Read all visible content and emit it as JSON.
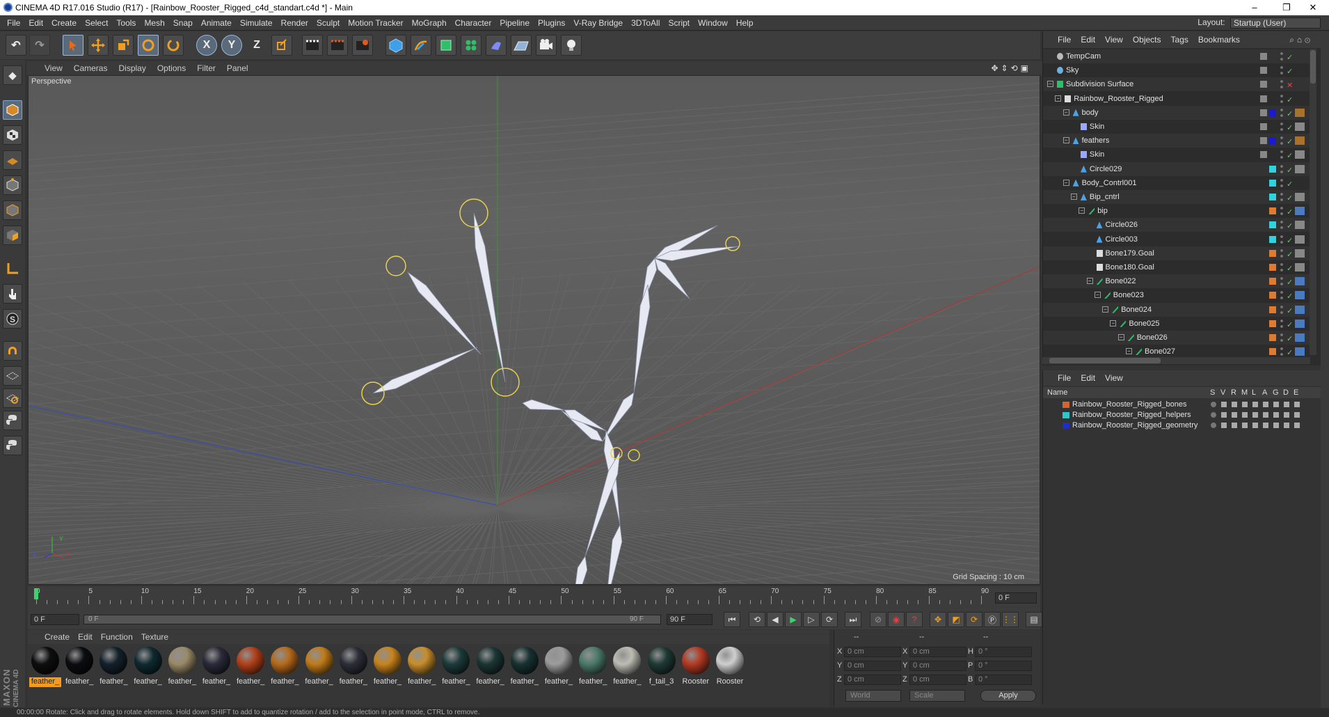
{
  "window": {
    "title": "CINEMA 4D R17.016 Studio (R17) - [Rainbow_Rooster_Rigged_c4d_standart.c4d *] - Main",
    "minimize": "–",
    "maximize": "❐",
    "close": "✕"
  },
  "menubar": [
    "File",
    "Edit",
    "Create",
    "Select",
    "Tools",
    "Mesh",
    "Snap",
    "Animate",
    "Simulate",
    "Render",
    "Sculpt",
    "Motion Tracker",
    "MoGraph",
    "Character",
    "Pipeline",
    "Plugins",
    "V-Ray Bridge",
    "3DToAll",
    "Script",
    "Window",
    "Help"
  ],
  "layout": {
    "label": "Layout:",
    "value": "Startup (User)"
  },
  "toolbar": {
    "x_label": "X",
    "y_label": "Y",
    "z_label": "Z"
  },
  "viewport": {
    "menu": [
      "View",
      "Cameras",
      "Display",
      "Options",
      "Filter",
      "Panel"
    ],
    "label": "Perspective",
    "grid_spacing": "Grid Spacing : 10 cm",
    "axis_x": "X",
    "axis_y": "Y",
    "axis_z": "Z"
  },
  "timeline": {
    "ticks": [
      "0",
      "5",
      "10",
      "15",
      "20",
      "25",
      "30",
      "35",
      "40",
      "45",
      "50",
      "55",
      "60",
      "65",
      "70",
      "75",
      "80",
      "85",
      "90"
    ],
    "current_frame": "0 F",
    "start_field": "0 F",
    "range_start": "0 F",
    "range_end": "90 F",
    "end_field": "90 F"
  },
  "materials": {
    "menu": [
      "Create",
      "Edit",
      "Function",
      "Texture"
    ],
    "items": [
      {
        "label": "feather_",
        "color": "#0e0e0e",
        "selected": true
      },
      {
        "label": "feather_",
        "color": "#0c0d10"
      },
      {
        "label": "feather_",
        "color": "#13212b"
      },
      {
        "label": "feather_",
        "color": "#0f2a30"
      },
      {
        "label": "feather_",
        "color": "#9a8a68"
      },
      {
        "label": "feather_",
        "color": "#2a2a3a"
      },
      {
        "label": "feather_",
        "color": "#b0401a"
      },
      {
        "label": "feather_",
        "color": "#b56a1c"
      },
      {
        "label": "feather_",
        "color": "#c07b1a"
      },
      {
        "label": "feather_",
        "color": "#2e2e3a"
      },
      {
        "label": "feather_",
        "color": "#c7841e"
      },
      {
        "label": "feather_",
        "color": "#c88e2a"
      },
      {
        "label": "feather_",
        "color": "#1d3b3a"
      },
      {
        "label": "feather_",
        "color": "#1c3535"
      },
      {
        "label": "feather_",
        "color": "#183232"
      },
      {
        "label": "feather_",
        "color": "#9c9c9c"
      },
      {
        "label": "feather_",
        "color": "#4c7a6a"
      },
      {
        "label": "feather_",
        "color": "#bdbdb5"
      },
      {
        "label": "f_tail_3",
        "color": "#1f3a33"
      },
      {
        "label": "Rooster",
        "color": "#b33a24"
      },
      {
        "label": "Rooster",
        "color": "#cfcfcf"
      }
    ]
  },
  "coords": {
    "headers": [
      "--",
      "--",
      "--"
    ],
    "rows": [
      {
        "l1": "X",
        "v1": "0 cm",
        "l2": "X",
        "v2": "0 cm",
        "l3": "H",
        "v3": "0 °"
      },
      {
        "l1": "Y",
        "v1": "0 cm",
        "l2": "Y",
        "v2": "0 cm",
        "l3": "P",
        "v3": "0 °"
      },
      {
        "l1": "Z",
        "v1": "0 cm",
        "l2": "Z",
        "v2": "0 cm",
        "l3": "B",
        "v3": "0 °"
      }
    ],
    "world": "World",
    "scale": "Scale",
    "apply": "Apply"
  },
  "objects": {
    "menu": [
      "File",
      "Edit",
      "View",
      "Objects",
      "Tags",
      "Bookmarks"
    ],
    "rows": [
      {
        "name": "TempCam",
        "indent": 0,
        "swatch": "",
        "icon": "camera"
      },
      {
        "name": "Sky",
        "indent": 0,
        "swatch": "",
        "icon": "sky"
      },
      {
        "name": "Subdivision Surface",
        "indent": 0,
        "swatch": "",
        "icon": "subdiv"
      },
      {
        "name": "Rainbow_Rooster_Rigged",
        "indent": 1,
        "swatch": "",
        "icon": "null"
      },
      {
        "name": "body",
        "indent": 2,
        "swatch": "#1a1ad0",
        "icon": "poly"
      },
      {
        "name": "Skin",
        "indent": 3,
        "swatch": "",
        "icon": "deformer"
      },
      {
        "name": "feathers",
        "indent": 2,
        "swatch": "#1a1ad0",
        "icon": "poly"
      },
      {
        "name": "Skin",
        "indent": 3,
        "swatch": "",
        "icon": "deformer"
      },
      {
        "name": "Circle029",
        "indent": 3,
        "swatch": "#2fd3e0",
        "icon": "spline"
      },
      {
        "name": "Body_Contrl001",
        "indent": 2,
        "swatch": "#2fd3e0",
        "icon": "spline"
      },
      {
        "name": "Bip_cntrl",
        "indent": 3,
        "swatch": "#2fd3e0",
        "icon": "spline"
      },
      {
        "name": "bip",
        "indent": 4,
        "swatch": "#e07a2f",
        "icon": "bone"
      },
      {
        "name": "Circle026",
        "indent": 5,
        "swatch": "#2fd3e0",
        "icon": "spline"
      },
      {
        "name": "Circle003",
        "indent": 5,
        "swatch": "#2fd3e0",
        "icon": "spline"
      },
      {
        "name": "Bone179.Goal",
        "indent": 5,
        "swatch": "#e07a2f",
        "icon": "null"
      },
      {
        "name": "Bone180.Goal",
        "indent": 5,
        "swatch": "#e07a2f",
        "icon": "null"
      },
      {
        "name": "Bone022",
        "indent": 5,
        "swatch": "#e07a2f",
        "icon": "bone"
      },
      {
        "name": "Bone023",
        "indent": 6,
        "swatch": "#e07a2f",
        "icon": "bone"
      },
      {
        "name": "Bone024",
        "indent": 7,
        "swatch": "#e07a2f",
        "icon": "bone"
      },
      {
        "name": "Bone025",
        "indent": 8,
        "swatch": "#e07a2f",
        "icon": "bone"
      },
      {
        "name": "Bone026",
        "indent": 9,
        "swatch": "#e07a2f",
        "icon": "bone"
      },
      {
        "name": "Bone027",
        "indent": 10,
        "swatch": "#e07a2f",
        "icon": "bone"
      }
    ]
  },
  "layers": {
    "menu": [
      "File",
      "Edit",
      "View"
    ],
    "headers": {
      "name": "Name",
      "cols": [
        "S",
        "V",
        "R",
        "M",
        "L",
        "A",
        "G",
        "D",
        "E"
      ]
    },
    "rows": [
      {
        "name": "Rainbow_Rooster_Rigged_bones",
        "color": "#d9642a"
      },
      {
        "name": "Rainbow_Rooster_Rigged_helpers",
        "color": "#31c6c9"
      },
      {
        "name": "Rainbow_Rooster_Rigged_geometry",
        "color": "#1d2fc8"
      }
    ]
  },
  "branding": {
    "maxon": "MAXON",
    "cinema": "CINEMA 4D"
  },
  "status": "00:00:00   Rotate: Click and drag to rotate elements. Hold down SHIFT to add to quantize rotation / add to the selection in point mode, CTRL to remove."
}
